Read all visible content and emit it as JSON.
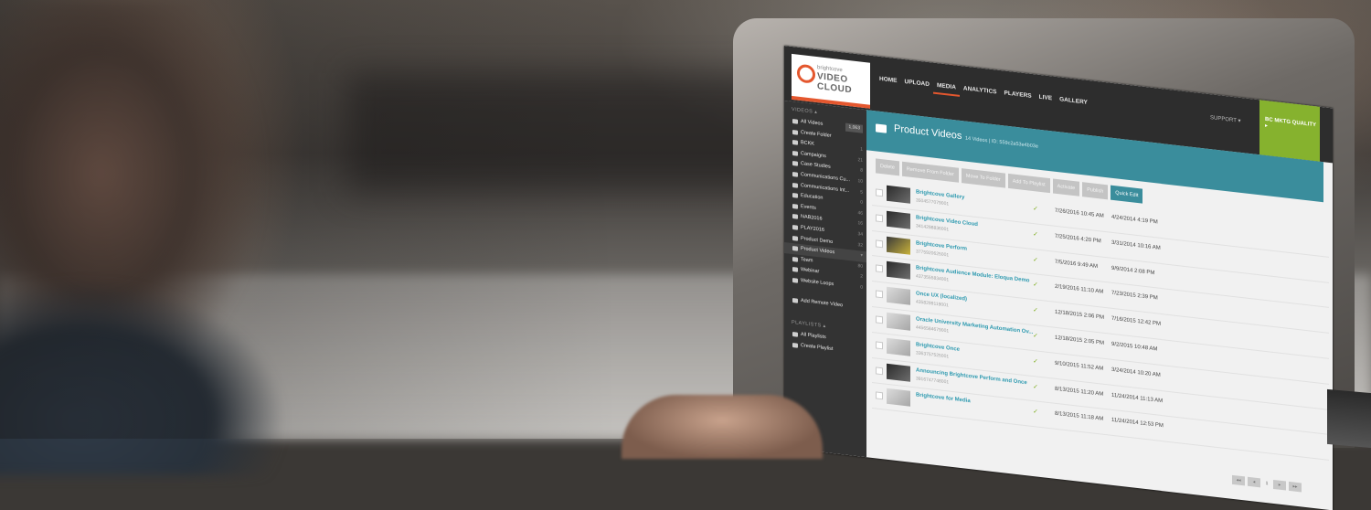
{
  "app": {
    "brand_small": "brightcove",
    "brand_large": "VIDEO CLOUD",
    "accent_color": "#e4572e",
    "teal_color": "#3a8d9c",
    "green_color": "#86b22e"
  },
  "nav": {
    "items": [
      {
        "label": "HOME"
      },
      {
        "label": "UPLOAD"
      },
      {
        "label": "MEDIA",
        "active": true
      },
      {
        "label": "ANALYTICS"
      },
      {
        "label": "PLAYERS"
      },
      {
        "label": "LIVE"
      },
      {
        "label": "GALLERY"
      }
    ],
    "support": "SUPPORT ▾",
    "account": "BC MKTG QUALITY ▸"
  },
  "sidebar": {
    "videos_header": "VIDEOS ▴",
    "all_videos": "All Videos",
    "all_videos_count": "1,063",
    "create_folder": "Create Folder",
    "folders": [
      {
        "label": "BCKK",
        "count": "1"
      },
      {
        "label": "Campaigns",
        "count": "21"
      },
      {
        "label": "Case Studies",
        "count": "8"
      },
      {
        "label": "Communications Cu...",
        "count": "10"
      },
      {
        "label": "Communications Int...",
        "count": "5"
      },
      {
        "label": "Education",
        "count": "0"
      },
      {
        "label": "Events",
        "count": "46"
      },
      {
        "label": "NAB2016",
        "count": "16"
      },
      {
        "label": "PLAY2016",
        "count": "34"
      },
      {
        "label": "Product Demo",
        "count": "32"
      },
      {
        "label": "Product Videos",
        "count": "▾"
      },
      {
        "label": "Team",
        "count": "80"
      },
      {
        "label": "Webinar",
        "count": "2"
      },
      {
        "label": "Website Loops",
        "count": "0"
      }
    ],
    "add_remote": "Add Remote Video",
    "playlists_header": "PLAYLISTS ▴",
    "all_playlists": "All Playlists",
    "create_playlist": "Create Playlist"
  },
  "folder": {
    "title": "Product Videos",
    "meta": "14 Videos   |   ID: 559c2a53e4b03e"
  },
  "toolbar": {
    "buttons": [
      "Delete",
      "Remove From Folder",
      "Move To Folder",
      "Add To Playlist",
      "Activate",
      "Publish"
    ],
    "quick_edit": "Quick Edit"
  },
  "videos": [
    {
      "name": "Brightcove Gallery",
      "id": "3504577079001",
      "created": "7/26/2016 10:45 AM",
      "updated": "4/24/2014 4:19 PM",
      "thumb": "dark"
    },
    {
      "name": "Brightcove Video Cloud",
      "id": "3414298836001",
      "created": "7/25/2016 4:20 PM",
      "updated": "3/31/2014 10:16 AM",
      "thumb": "dark"
    },
    {
      "name": "Brightcove Perform",
      "id": "3775920625001",
      "created": "7/5/2016 9:49 AM",
      "updated": "9/9/2014 2:08 PM",
      "thumb": "yellow"
    },
    {
      "name": "Brightcove Audience Module: Eloqua Demo",
      "id": "4373555834001",
      "created": "2/19/2016 11:10 AM",
      "updated": "7/23/2015 2:39 PM",
      "thumb": "dark"
    },
    {
      "name": "Once UX (localized)",
      "id": "4358299119001",
      "created": "12/18/2015 2:06 PM",
      "updated": "7/16/2015 12:42 PM",
      "thumb": "light"
    },
    {
      "name": "Oracle University Marketing Automation Ov...",
      "id": "4456584679001",
      "created": "12/18/2015 2:05 PM",
      "updated": "9/2/2015 10:48 AM",
      "thumb": "light"
    },
    {
      "name": "Brightcove Once",
      "id": "3363757525001",
      "created": "9/10/2015 11:52 AM",
      "updated": "3/24/2014 10:20 AM",
      "thumb": "light"
    },
    {
      "name": "Announcing Brightcove Perform and Once",
      "id": "3916747748001",
      "created": "8/13/2015 11:20 AM",
      "updated": "11/24/2014 11:13 AM",
      "thumb": "dark"
    },
    {
      "name": "Brightcove for Media",
      "id": "",
      "created": "8/13/2015 11:18 AM",
      "updated": "11/24/2014 12:53 PM",
      "thumb": "light"
    }
  ],
  "pager": {
    "first": "◂◂",
    "prev": "◂",
    "current": "1",
    "next": "▸",
    "last": "▸▸"
  }
}
